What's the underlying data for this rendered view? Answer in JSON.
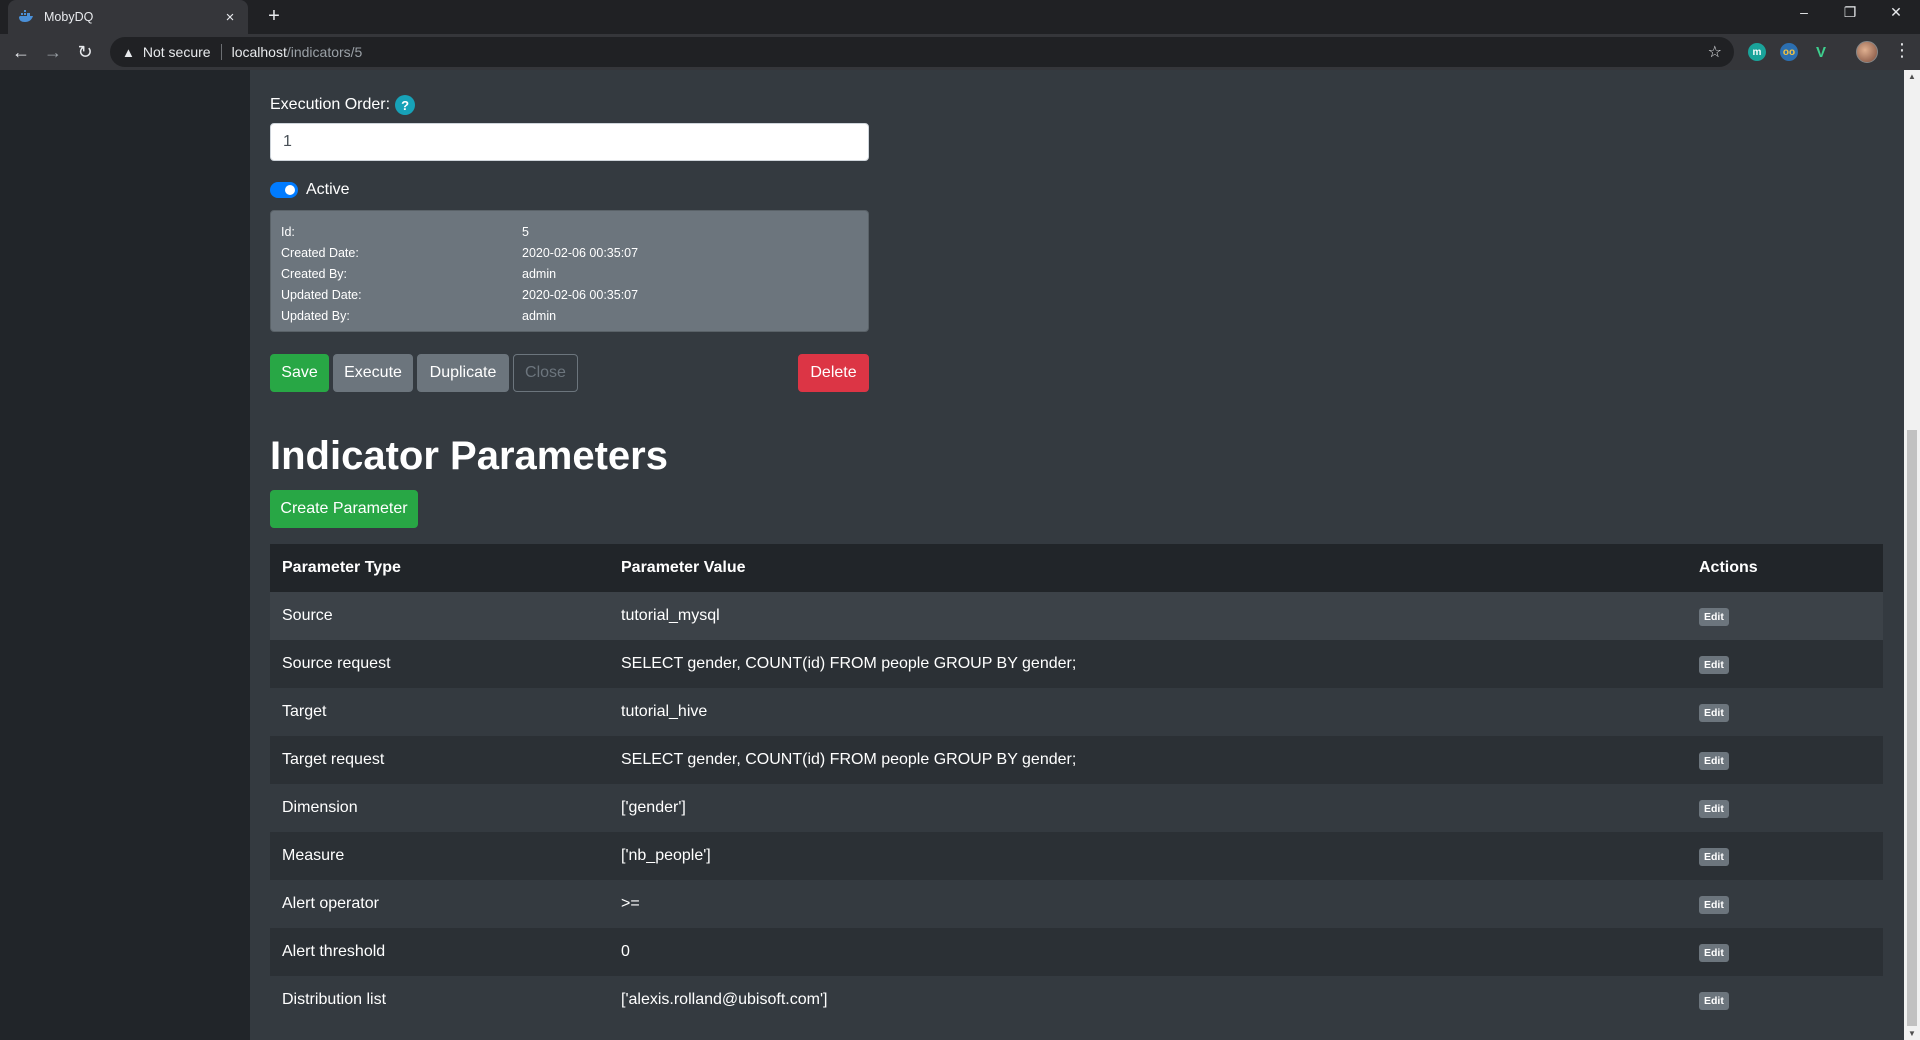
{
  "browser": {
    "tab_title": "MobyDQ",
    "tab_close": "×",
    "new_tab": "+",
    "not_secure": "Not secure",
    "url_host": "localhost",
    "url_path": "/indicators/5"
  },
  "form": {
    "execution_order_label": "Execution Order:",
    "help_icon": "?",
    "execution_order_value": "1",
    "active_label": "Active",
    "active": true
  },
  "meta": [
    {
      "key": "Id:",
      "value": "5"
    },
    {
      "key": "Created Date:",
      "value": "2020-02-06 00:35:07"
    },
    {
      "key": "Created By:",
      "value": "admin"
    },
    {
      "key": "Updated Date:",
      "value": "2020-02-06 00:35:07"
    },
    {
      "key": "Updated By:",
      "value": "admin"
    }
  ],
  "actions": {
    "save": "Save",
    "execute": "Execute",
    "duplicate": "Duplicate",
    "close": "Close",
    "delete": "Delete"
  },
  "parameters": {
    "title": "Indicator Parameters",
    "create_button": "Create Parameter",
    "headers": {
      "type": "Parameter Type",
      "value": "Parameter Value",
      "actions": "Actions"
    },
    "edit_label": "Edit",
    "rows": [
      {
        "type": "Source",
        "value": "tutorial_mysql"
      },
      {
        "type": "Source request",
        "value": "SELECT gender, COUNT(id) FROM people GROUP BY gender;"
      },
      {
        "type": "Target",
        "value": "tutorial_hive"
      },
      {
        "type": "Target request",
        "value": "SELECT gender, COUNT(id) FROM people GROUP BY gender;"
      },
      {
        "type": "Dimension",
        "value": "['gender']"
      },
      {
        "type": "Measure",
        "value": "['nb_people']"
      },
      {
        "type": "Alert operator",
        "value": ">="
      },
      {
        "type": "Alert threshold",
        "value": "0"
      },
      {
        "type": "Distribution list",
        "value": "['alexis.rolland@ubisoft.com']"
      }
    ]
  },
  "colors": {
    "success": "#28a745",
    "secondary": "#6c757d",
    "danger": "#dc3545",
    "primary": "#007bff",
    "info": "#17a2b8"
  }
}
